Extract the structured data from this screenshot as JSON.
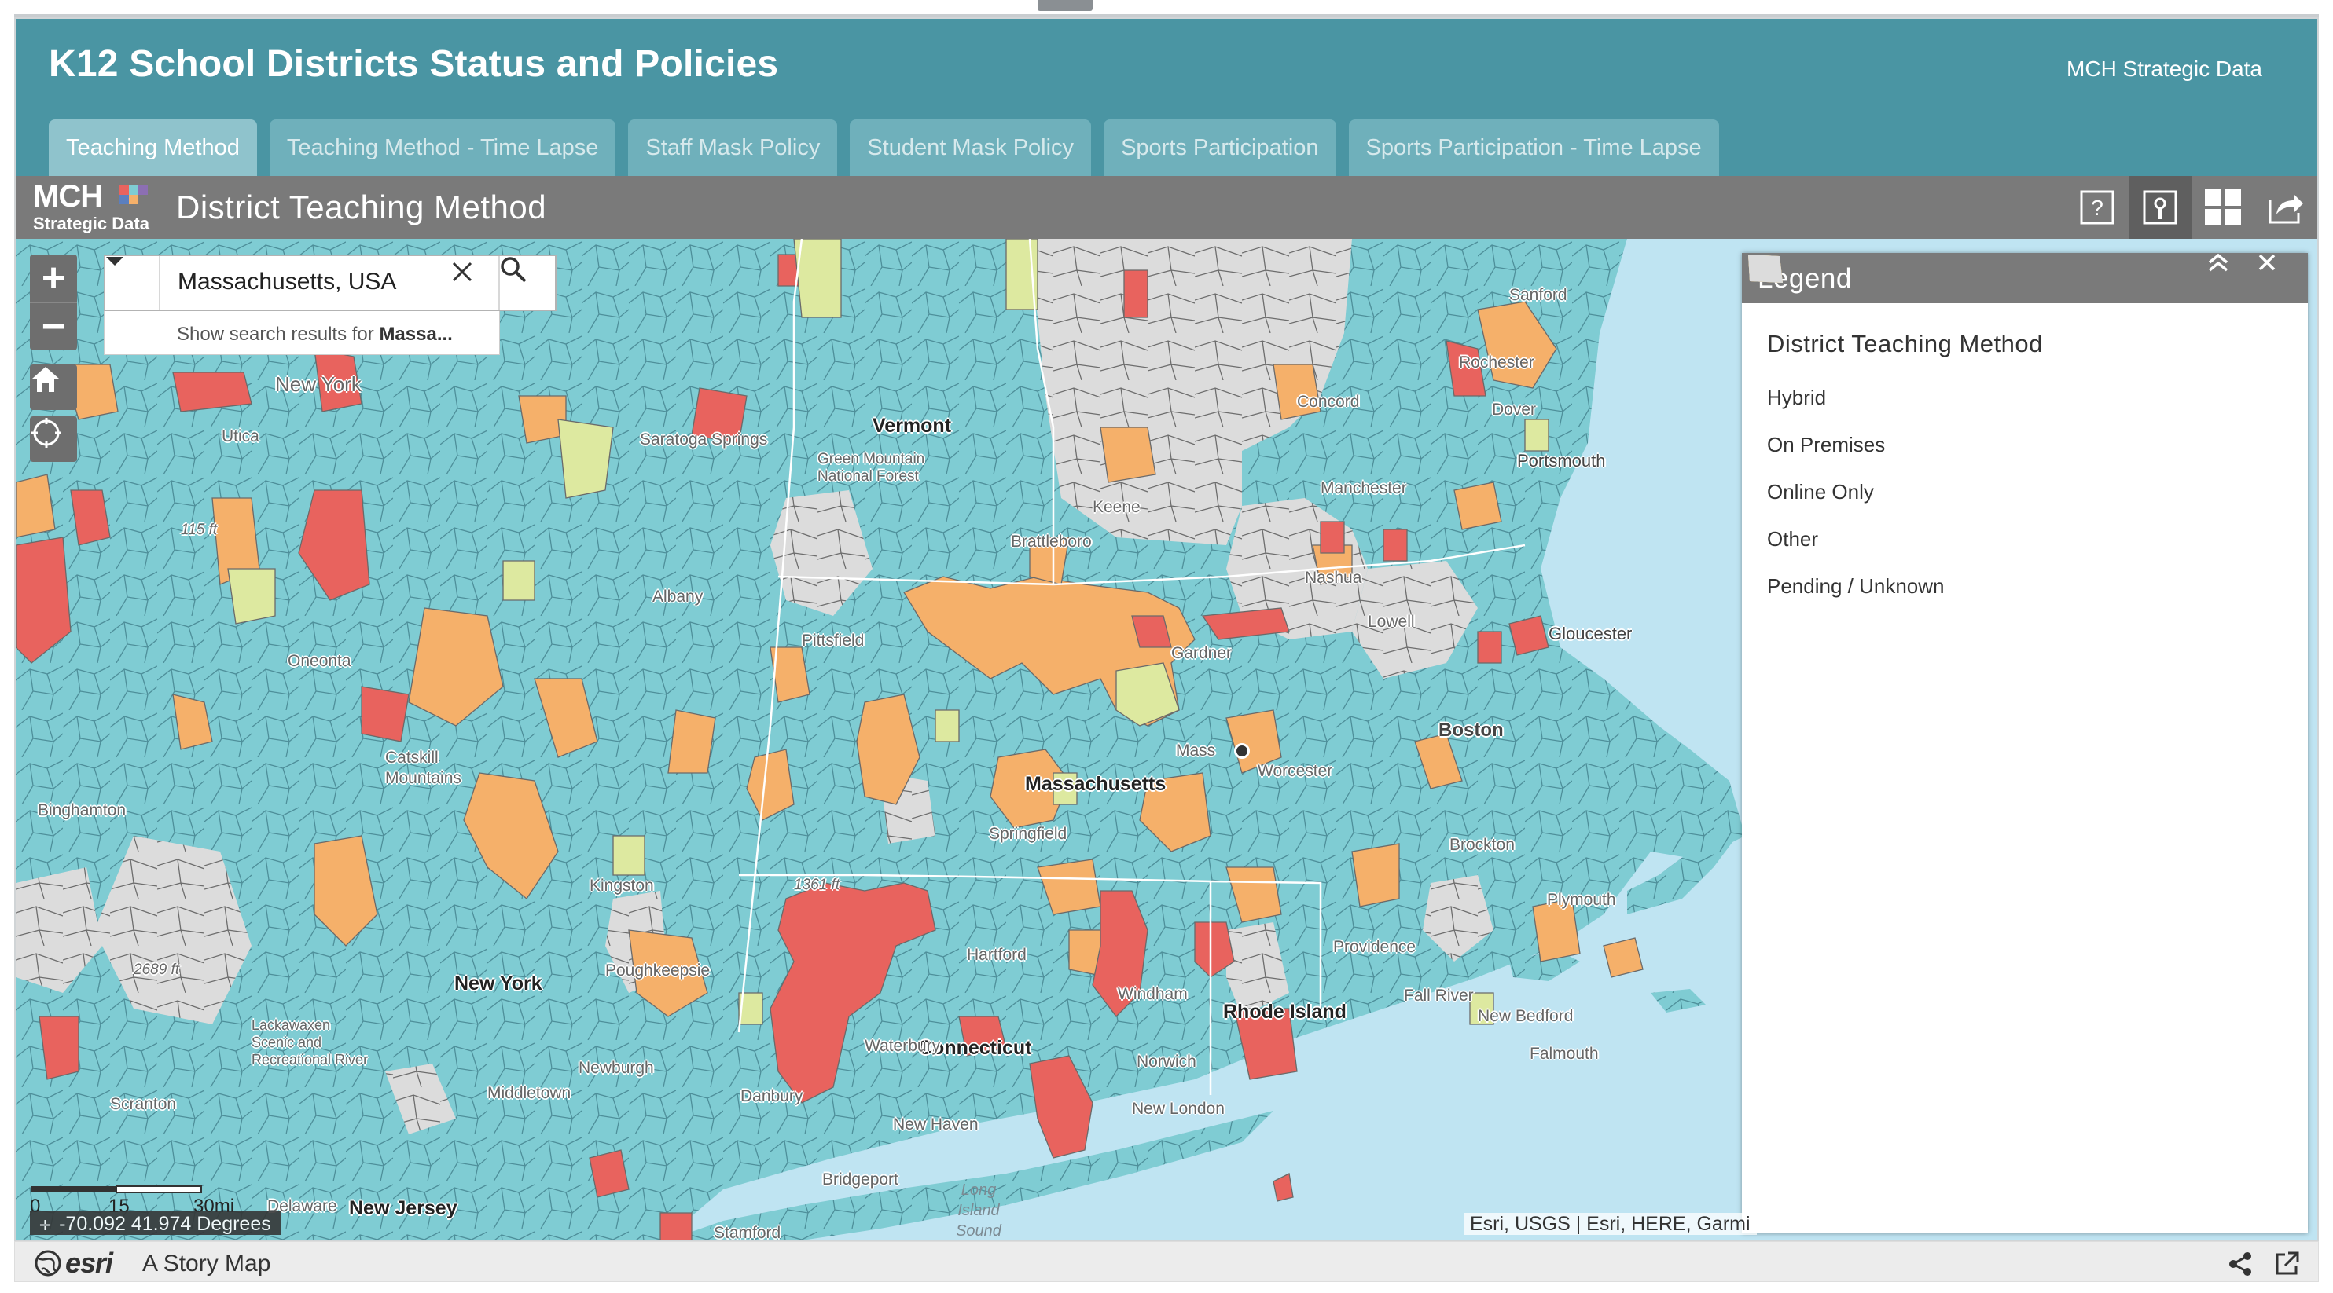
{
  "header": {
    "title": "K12 School Districts Status and Policies",
    "subtitle": "MCH Strategic Data",
    "tabs": [
      {
        "label": "Teaching Method",
        "active": true
      },
      {
        "label": "Teaching Method - Time Lapse",
        "active": false
      },
      {
        "label": "Staff Mask Policy",
        "active": false
      },
      {
        "label": "Student Mask Policy",
        "active": false
      },
      {
        "label": "Sports Participation",
        "active": false
      },
      {
        "label": "Sports Participation - Time Lapse",
        "active": false
      }
    ]
  },
  "section": {
    "logo_top": "MCH",
    "logo_bottom": "Strategic Data",
    "title": "District Teaching Method",
    "icons": [
      "help-icon",
      "legend-icon",
      "grid-icon",
      "share-icon"
    ]
  },
  "search": {
    "value": "Massachusetts, USA",
    "suggestion_prefix": "Show search results for ",
    "suggestion_term": "Massa..."
  },
  "legend": {
    "header": "Legend",
    "layer_title": "District Teaching Method",
    "items": [
      {
        "label": "Hybrid",
        "color": "#7fccd3"
      },
      {
        "label": "On Premises",
        "color": "#e8635e"
      },
      {
        "label": "Online Only",
        "color": "#f5b06a"
      },
      {
        "label": "Other",
        "color": "#dde9a0"
      },
      {
        "label": "Pending / Unknown",
        "color": "#dcdcdc"
      }
    ]
  },
  "map": {
    "state_labels": [
      "Vermont",
      "New York",
      "Massachusetts",
      "Connecticut",
      "Rhode Island",
      "New Jersey"
    ],
    "place_labels": [
      "New York",
      "Utica",
      "Saratoga Springs",
      "Albany",
      "Oneonta",
      "Binghamton",
      "Kingston",
      "Poughkeepsie",
      "Newburgh",
      "Middletown",
      "Scranton",
      "Pittsfield",
      "Springfield",
      "Hartford",
      "Waterbury",
      "New Haven",
      "Bridgeport",
      "Stamford",
      "Danbury",
      "Norwich",
      "New London",
      "Windham",
      "Providence",
      "Fall River",
      "New Bedford",
      "Falmouth",
      "Plymouth",
      "Brockton",
      "Boston",
      "Worcester",
      "Gardner",
      "Lowell",
      "Gloucester",
      "Manchester",
      "Nashua",
      "Concord",
      "Portsmouth",
      "Dover",
      "Rochester",
      "Sanford",
      "Keene",
      "Brattleboro",
      "Green Mountain National Forest",
      "Catskill Mountains",
      "Delaware",
      "Mass",
      "Lackawaxen Scenic and Recreational River"
    ],
    "elevations": [
      "2689 ft",
      "1361 ft",
      "115 ft"
    ],
    "water_label": "Long Island Sound",
    "scale_labels": [
      "0",
      "15",
      "30mi"
    ],
    "coordinates": "-70.092 41.974 Degrees",
    "attribution": "Esri, USGS | Esri, HERE, Garmi"
  },
  "footer": {
    "brand": "esri",
    "label": "A Story Map"
  }
}
